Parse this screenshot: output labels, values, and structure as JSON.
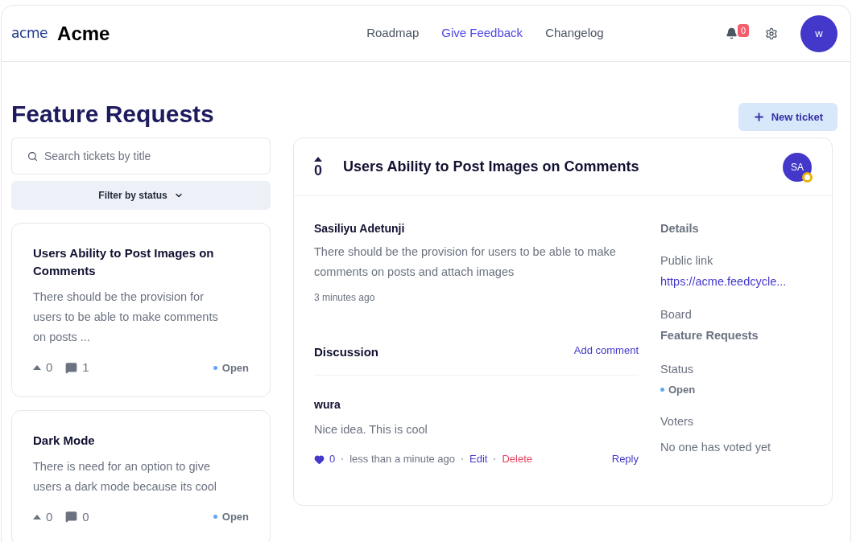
{
  "brand": {
    "logo_text": "acme",
    "name": "Acme"
  },
  "nav": [
    {
      "label": "Roadmap",
      "selected": false
    },
    {
      "label": "Give Feedback",
      "selected": true
    },
    {
      "label": "Changelog",
      "selected": false
    }
  ],
  "notifications": {
    "count": "0"
  },
  "user": {
    "initial": "w"
  },
  "page_title": "Feature Requests",
  "new_ticket_button": "New ticket",
  "search": {
    "placeholder": "Search tickets by title"
  },
  "filter": {
    "label": "Filter by status"
  },
  "tickets": [
    {
      "title": "Users Ability to Post Images on Comments",
      "excerpt": "There should be the provision for users to be able to make comments on posts ...",
      "votes": "0",
      "comments": "1",
      "status": "Open",
      "color": "#60a5fa"
    },
    {
      "title": "Dark Mode",
      "excerpt": "There is need for an option to give users a dark mode because its cool",
      "votes": "0",
      "comments": "0",
      "status": "Open",
      "color": "#60a5fa"
    }
  ],
  "detail": {
    "votes": "0",
    "title": "Users Ability to Post Images on Comments",
    "avatar_initials": "SA",
    "author": "Sasiliyu Adetunji",
    "body": "There should be the provision for users to be able to make comments on posts and attach images",
    "time": "3 minutes ago",
    "discussion": {
      "heading": "Discussion",
      "add_comment": "Add comment",
      "comments": [
        {
          "author": "wura",
          "text": "Nice idea. This is cool",
          "likes": "0",
          "time": "less than a minute ago",
          "actions": [
            {
              "label": "Edit",
              "kind": "edit"
            },
            {
              "label": "Delete",
              "kind": "delete"
            }
          ],
          "reply": "Reply"
        }
      ]
    },
    "sidebar": {
      "heading": "Details",
      "public_link_label": "Public link",
      "public_link": "https://acme.feedcycle...",
      "board_label": "Board",
      "board": "Feature Requests",
      "status_label": "Status",
      "status": {
        "label": "Open",
        "color": "#60a5fa"
      },
      "voters_label": "Voters",
      "voters": "No one has voted yet"
    }
  }
}
